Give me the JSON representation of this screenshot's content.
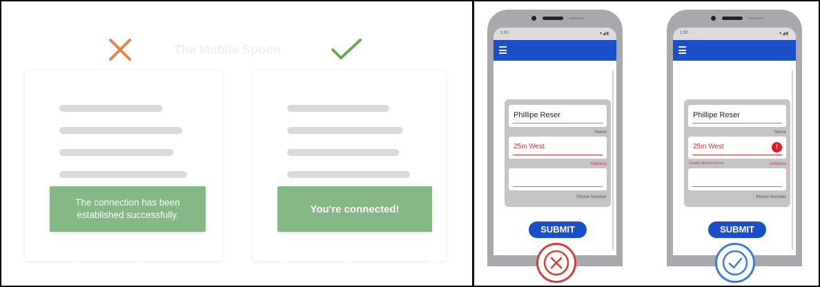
{
  "left": {
    "watermark": "The Mobile Spoon",
    "bad_card": {
      "message": "The connection has been established successfully."
    },
    "good_card": {
      "message": "You're connected!"
    }
  },
  "phones": [
    {
      "status_time": "1:00",
      "status_icons": "▾◢▮",
      "name_value": "Phillipe Reser",
      "name_caption": "Name",
      "address_value": "25m West",
      "address_caption": "Address",
      "phone_caption": "Phone Number",
      "submit_label": "SUBMIT"
    },
    {
      "status_time": "1:00",
      "status_icons": "▾◢▮",
      "name_value": "Phillipe Reser",
      "name_caption": "Name",
      "address_value": "25m West",
      "address_caption": "Address",
      "address_helper": "Invalid address format",
      "error_icon": "!",
      "phone_caption": "Phone Number",
      "submit_label": "SUBMIT"
    }
  ],
  "colors": {
    "bad": "#e8804a",
    "good": "#6aa84f",
    "toast": "#84b885",
    "appbar": "#1b4fc7",
    "error": "#d93636",
    "badge_bad": "#d83a3a",
    "badge_good": "#3d78df"
  },
  "icons": [
    "cross-mark-icon",
    "check-mark-icon",
    "menu-icon",
    "error-icon",
    "x-circle-icon",
    "check-circle-icon"
  ]
}
